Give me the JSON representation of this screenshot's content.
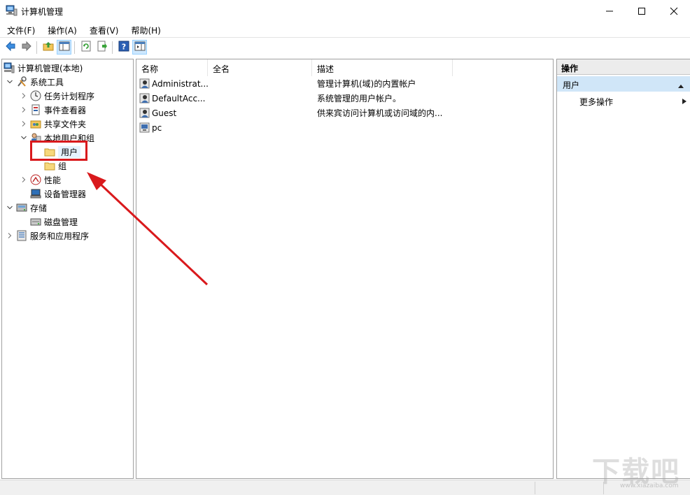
{
  "window": {
    "title": "计算机管理",
    "controls": [
      "minimize",
      "maximize",
      "close"
    ]
  },
  "menu": [
    "文件(F)",
    "操作(A)",
    "查看(V)",
    "帮助(H)"
  ],
  "toolbar": [
    "back-icon",
    "forward-icon",
    "up-folder-icon",
    "show-hide-tree-icon",
    "refresh-icon",
    "export-list-icon",
    "help-icon",
    "show-hide-action-pane-icon"
  ],
  "tree": {
    "root": "计算机管理(本地)",
    "system_tools": "系统工具",
    "task_scheduler": "任务计划程序",
    "event_viewer": "事件查看器",
    "shared_folders": "共享文件夹",
    "local_users_groups": "本地用户和组",
    "users": "用户",
    "groups": "组",
    "performance": "性能",
    "device_manager": "设备管理器",
    "storage": "存储",
    "disk_management": "磁盘管理",
    "services_apps": "服务和应用程序"
  },
  "list": {
    "columns": [
      "名称",
      "全名",
      "描述"
    ],
    "rows": [
      {
        "name": "Administrat...",
        "fullname": "",
        "desc": "管理计算机(域)的内置帐户"
      },
      {
        "name": "DefaultAcc...",
        "fullname": "",
        "desc": "系统管理的用户帐户。"
      },
      {
        "name": "Guest",
        "fullname": "",
        "desc": "供来宾访问计算机或访问域的内..."
      },
      {
        "name": "pc",
        "fullname": "",
        "desc": ""
      }
    ]
  },
  "actions": {
    "title": "操作",
    "section": "用户",
    "more": "更多操作"
  },
  "watermark": {
    "main": "下载吧",
    "sub": "www.xiazaiba.com"
  },
  "colors": {
    "highlight": "#d9191c",
    "section_bg": "#d0e6f8"
  }
}
